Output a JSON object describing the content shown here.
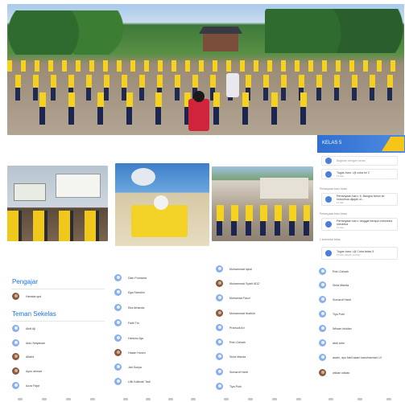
{
  "colors": {
    "accent": "#1a73e8",
    "class_banner": "#2f6fd1",
    "uniform_yellow": "#f5d21e"
  },
  "classroom_app": {
    "class_name": "KELAS 5",
    "announce_placeholder": "Bagikan dengan kelas",
    "stream": [
      {
        "label": "",
        "title": "Tugas baru: Uji coba ke 2",
        "time": "11 Mei"
      },
      {
        "label": "Pertanyaan baru kelas",
        "title": "Pertanyaan baru: 5. Bangsa tahun ke Indonesia dijajah ol...",
        "time": "11 Mei"
      },
      {
        "label": "Pertanyaan baru kelas",
        "title": "Pertanyaan baru: tanggal berapa Indonesia merdeka",
        "time": "10 Mei"
      },
      {
        "label": "1 komentar kelas",
        "title": "Tugas baru: Uji Coba kelas 5",
        "time": "10 Mei (Diedit 14 Mei)"
      }
    ]
  },
  "people_panel_1": {
    "teachers_heading": "Pengajar",
    "teacher": "Hamida spd",
    "classmates_heading": "Teman Sekelas",
    "classmates": [
      "Abdi Aji",
      "Aldo Setyawan",
      "Alfarid",
      "Ayon ahmad",
      "Azza Fajar"
    ]
  },
  "people_panel_2": {
    "names": [
      "Dian Purnama",
      "Ega Ramdini",
      "Eka Afrianda",
      "Fadil Tio",
      "Hartono Aja",
      "Hasan Husen",
      "Jati Suriya",
      "Lilik Kalimah Tadi"
    ]
  },
  "people_panel_3": {
    "names": [
      "Muhammad Iqbal",
      "Muhammad Syarif ADZ",
      "Muhamad Fauzi",
      "Muhammad Ibrahim",
      "Pramudi Ari",
      "Putri Zahrah",
      "Sinta Manda",
      "Sumardi Hardi",
      "Tiya Putri"
    ]
  },
  "people_panel_4": {
    "names": [
      "Putri Zahrah",
      "Sinta Manda",
      "Sumardi Hardi",
      "Tiya Putri",
      "Wirsan Iskidan",
      "abdi aritn",
      "aswin, ayu fabil azam kanuharmani Ul",
      "wildan wildan"
    ]
  }
}
